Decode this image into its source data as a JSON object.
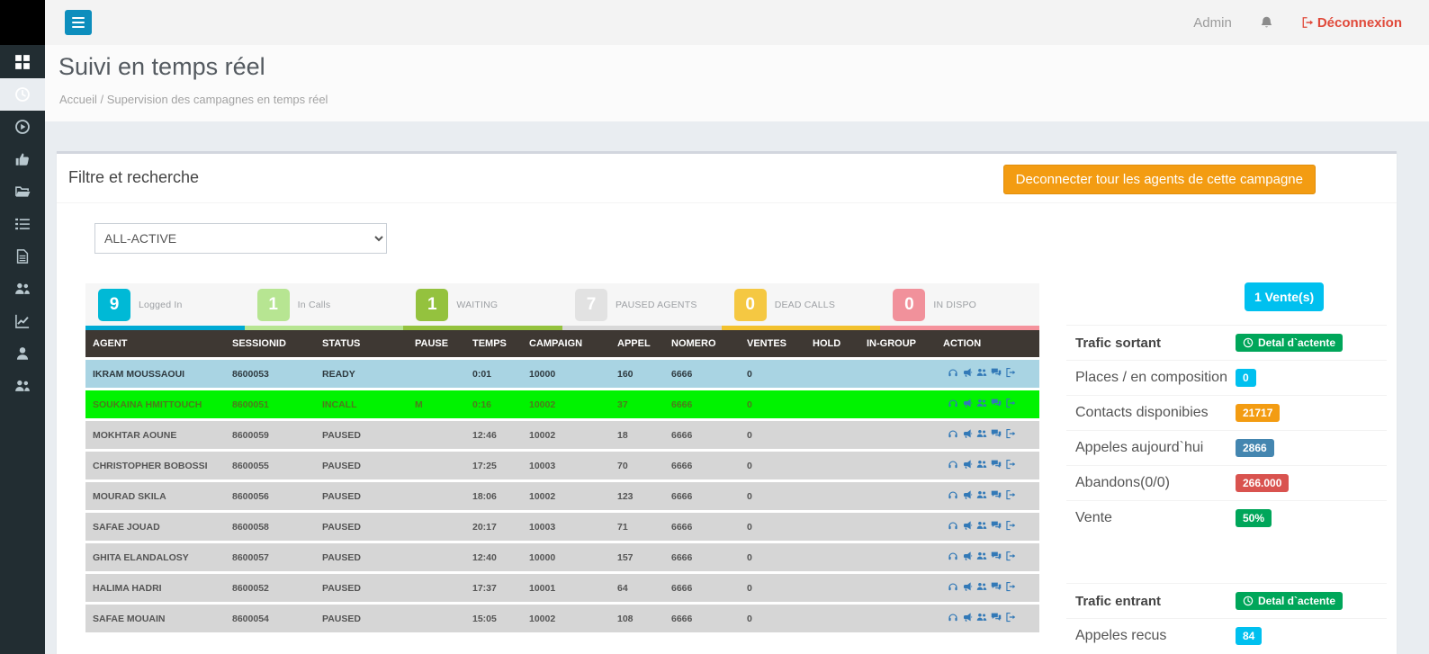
{
  "topbar": {
    "user": "Admin",
    "logout_label": "Déconnexion"
  },
  "page": {
    "title": "Suivi en temps réel",
    "breadcrumb": "Accueil / Supervision des campagnes en temps réel"
  },
  "sidebar": {
    "items": [
      {
        "id": "dashboard",
        "icon": "grid-icon",
        "active": false
      },
      {
        "id": "realtime-supervision",
        "icon": "clock-icon",
        "active": true
      },
      {
        "id": "monitoring",
        "icon": "play-circle-icon",
        "active": false
      },
      {
        "id": "quality",
        "icon": "thumbs-up-icon",
        "active": false
      },
      {
        "id": "campaigns",
        "icon": "folder-open-icon",
        "active": false
      },
      {
        "id": "lists",
        "icon": "list-icon",
        "active": false
      },
      {
        "id": "documents",
        "icon": "file-icon",
        "active": false
      },
      {
        "id": "agents",
        "icon": "users-icon",
        "active": false
      },
      {
        "id": "statistics",
        "icon": "chart-line-icon",
        "active": false
      },
      {
        "id": "profile",
        "icon": "user-icon",
        "active": false
      },
      {
        "id": "groups",
        "icon": "users-icon",
        "active": false
      }
    ]
  },
  "filter_panel": {
    "title": "Filtre et recherche",
    "disconnect_button": "Deconnecter tour les agents de cette campagne",
    "campaign_select_value": "ALL-ACTIVE"
  },
  "stats": [
    {
      "value": "9",
      "label": "Logged In",
      "box_color": "#00b9d6",
      "bar_color": "#00aad4",
      "value_color": "#ffffff"
    },
    {
      "value": "1",
      "label": "In Calls",
      "box_color": "#b7e592",
      "bar_color": "#b7e592",
      "value_color": "#ffffff"
    },
    {
      "value": "1",
      "label": "WAITING",
      "box_color": "#94c23e",
      "bar_color": "#94c23e",
      "value_color": "#ffffff"
    },
    {
      "value": "7",
      "label": "PAUSED AGENTS",
      "box_color": "#e2e2e2",
      "bar_color": "#d8d8d8",
      "value_color": "#ffffff"
    },
    {
      "value": "0",
      "label": "DEAD CALLS",
      "box_color": "#f5c842",
      "bar_color": "#f2c12e",
      "value_color": "#ffffff"
    },
    {
      "value": "0",
      "label": "IN DISPO",
      "box_color": "#f1919b",
      "bar_color": "#f5929c",
      "value_color": "#ffffff"
    }
  ],
  "table": {
    "columns": [
      "AGENT",
      "SESSIONID",
      "STATUS",
      "PAUSE",
      "TEMPS",
      "CAMPAIGN",
      "APPEL",
      "NOMERO",
      "VENTES",
      "HOLD",
      "IN-GROUP",
      "ACTION"
    ],
    "action_icons": [
      "headphones-icon",
      "bullhorn-icon",
      "users-icon",
      "comments-icon",
      "signout-icon"
    ],
    "rows": [
      {
        "agent": "IKRAM MOUSSAOUI",
        "sessionid": "8600053",
        "status": "READY",
        "pause": "",
        "temps": "0:01",
        "campaign": "10000",
        "appel": "160",
        "nomero": "6666",
        "ventes": "0",
        "hold": "",
        "in_group": "",
        "row_color": "#a9d4e3",
        "text_color": "#2f3a40"
      },
      {
        "agent": "SOUKAINA HMITTOUCH",
        "sessionid": "8600051",
        "status": "INCALL",
        "pause": "M",
        "temps": "0:16",
        "campaign": "10002",
        "appel": "37",
        "nomero": "6666",
        "ventes": "0",
        "hold": "",
        "in_group": "",
        "row_color": "#00f300",
        "text_color": "#4e7a1e"
      },
      {
        "agent": "MOKHTAR AOUNE",
        "sessionid": "8600059",
        "status": "PAUSED",
        "pause": "",
        "temps": "12:46",
        "campaign": "10002",
        "appel": "18",
        "nomero": "6666",
        "ventes": "0",
        "hold": "",
        "in_group": "",
        "row_color": "#d6d6d6",
        "text_color": "#555555"
      },
      {
        "agent": "CHRISTOPHER BOBOSSI",
        "sessionid": "8600055",
        "status": "PAUSED",
        "pause": "",
        "temps": "17:25",
        "campaign": "10003",
        "appel": "70",
        "nomero": "6666",
        "ventes": "0",
        "hold": "",
        "in_group": "",
        "row_color": "#d6d6d6",
        "text_color": "#555555"
      },
      {
        "agent": "MOURAD SKILA",
        "sessionid": "8600056",
        "status": "PAUSED",
        "pause": "",
        "temps": "18:06",
        "campaign": "10002",
        "appel": "123",
        "nomero": "6666",
        "ventes": "0",
        "hold": "",
        "in_group": "",
        "row_color": "#d6d6d6",
        "text_color": "#555555"
      },
      {
        "agent": "SAFAE JOUAD",
        "sessionid": "8600058",
        "status": "PAUSED",
        "pause": "",
        "temps": "20:17",
        "campaign": "10003",
        "appel": "71",
        "nomero": "6666",
        "ventes": "0",
        "hold": "",
        "in_group": "",
        "row_color": "#d6d6d6",
        "text_color": "#555555"
      },
      {
        "agent": "GHITA ELANDALOSY",
        "sessionid": "8600057",
        "status": "PAUSED",
        "pause": "",
        "temps": "12:40",
        "campaign": "10000",
        "appel": "157",
        "nomero": "6666",
        "ventes": "0",
        "hold": "",
        "in_group": "",
        "row_color": "#d6d6d6",
        "text_color": "#555555"
      },
      {
        "agent": "HALIMA HADRI",
        "sessionid": "8600052",
        "status": "PAUSED",
        "pause": "",
        "temps": "17:37",
        "campaign": "10001",
        "appel": "64",
        "nomero": "6666",
        "ventes": "0",
        "hold": "",
        "in_group": "",
        "row_color": "#d6d6d6",
        "text_color": "#555555"
      },
      {
        "agent": "SAFAE MOUAIN",
        "sessionid": "8600054",
        "status": "PAUSED",
        "pause": "",
        "temps": "15:05",
        "campaign": "10002",
        "appel": "108",
        "nomero": "6666",
        "ventes": "0",
        "hold": "",
        "in_group": "",
        "row_color": "#d6d6d6",
        "text_color": "#555555"
      }
    ]
  },
  "right_panel": {
    "ventes_button": {
      "label": "1 Vente(s)",
      "color": "#00c0ef"
    },
    "rows": [
      {
        "label": "Trafic sortant",
        "bold": true,
        "badge": {
          "text": "Detal d`actente",
          "color": "#00a65a",
          "icon": "clock-icon"
        }
      },
      {
        "label": "Places / en composition",
        "bold": false,
        "badge": {
          "text": "0",
          "color": "#00c0ef"
        }
      },
      {
        "label": "Contacts disponibies",
        "bold": false,
        "badge": {
          "text": "21717",
          "color": "#f39c12"
        }
      },
      {
        "label": "Appeles aujourd`hui",
        "bold": false,
        "badge": {
          "text": "2866",
          "color": "#4486b0"
        }
      },
      {
        "label": "Abandons(0/0)",
        "bold": false,
        "badge": {
          "text": "266.000",
          "color": "#d9534f"
        }
      },
      {
        "label": "Vente",
        "bold": false,
        "badge": {
          "text": "50%",
          "color": "#00a65a"
        }
      },
      {
        "label": "Trafic entrant",
        "bold": true,
        "spacer_before": true,
        "badge": {
          "text": "Detal d`actente",
          "color": "#00a65a",
          "icon": "clock-icon"
        }
      },
      {
        "label": "Appeles recus",
        "bold": false,
        "badge": {
          "text": "84",
          "color": "#00c0ef"
        }
      }
    ]
  }
}
